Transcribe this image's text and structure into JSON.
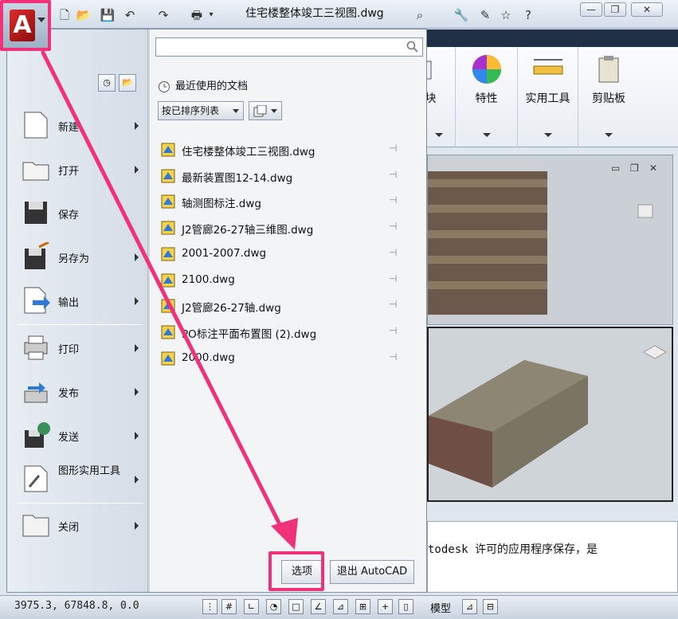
{
  "titlebar": {
    "doc_title": "住宅楼整体竣工三视图.dwg"
  },
  "ribbon": {
    "groups": [
      {
        "label": "块"
      },
      {
        "label": "特性"
      },
      {
        "label": "实用工具"
      },
      {
        "label": "剪贴板"
      }
    ]
  },
  "app_menu": {
    "search_value": "",
    "recent_title": "最近使用的文档",
    "sort_label": "按已排序列表",
    "items": [
      {
        "label": "新建"
      },
      {
        "label": "打开"
      },
      {
        "label": "保存"
      },
      {
        "label": "另存为"
      },
      {
        "label": "输出"
      },
      {
        "label": "打印"
      },
      {
        "label": "发布"
      },
      {
        "label": "发送"
      },
      {
        "label": "图形实用工具"
      },
      {
        "label": "关闭"
      }
    ],
    "recent_files": [
      "住宅楼整体竣工三视图.dwg",
      "最新装置图12-14.dwg",
      "轴测图标注.dwg",
      "J2管廊26-27轴三维图.dwg",
      "2001-2007.dwg",
      "2100.dwg",
      "J2管廊26-27轴.dwg",
      "PO标注平面布置图 (2).dwg",
      "2000.dwg"
    ],
    "options_label": "选项",
    "exit_label": "退出 AutoCAD"
  },
  "command_line": {
    "text": "todesk 许可的应用程序保存，是"
  },
  "status_bar": {
    "coords": "3975.3,   67848.8, 0.0",
    "model_label": "模型"
  },
  "colors": {
    "highlight": "#f0327a",
    "menu_bg": "#f2f4f6"
  }
}
